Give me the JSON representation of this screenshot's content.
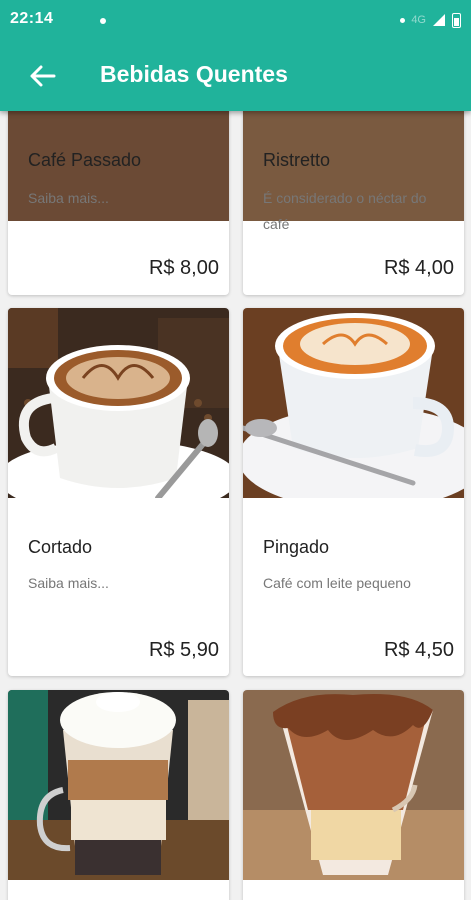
{
  "status_bar": {
    "time": "22:14",
    "network": "4G"
  },
  "toolbar": {
    "title": "Bebidas Quentes",
    "back_icon": "arrow-back-icon"
  },
  "colors": {
    "primary": "#20b39b",
    "card": "#ffffff",
    "background": "#f1f1f1"
  },
  "products": [
    {
      "name": "Café Passado",
      "description": "Saiba mais...",
      "price": "R$ 8,00"
    },
    {
      "name": "Ristretto",
      "description": "É considerado o néctar do café",
      "price": "R$ 4,00"
    },
    {
      "name": "Cortado",
      "description": "Saiba mais...",
      "price": "R$ 5,90"
    },
    {
      "name": "Pingado",
      "description": "Café com leite pequeno",
      "price": "R$ 4,50"
    }
  ]
}
